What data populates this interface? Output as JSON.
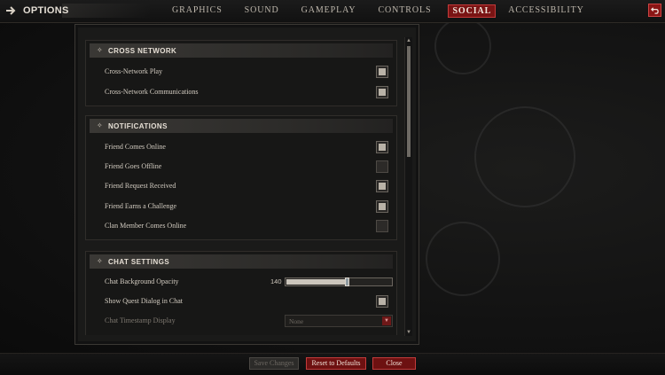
{
  "header": {
    "title": "OPTIONS",
    "tabs": [
      {
        "label": "GRAPHICS",
        "active": false
      },
      {
        "label": "SOUND",
        "active": false
      },
      {
        "label": "GAMEPLAY",
        "active": false
      },
      {
        "label": "CONTROLS",
        "active": false
      },
      {
        "label": "SOCIAL",
        "active": true
      },
      {
        "label": "ACCESSIBILITY",
        "active": false
      }
    ]
  },
  "sections": {
    "cross_network": {
      "title": "CROSS NETWORK",
      "items": [
        {
          "label": "Cross-Network Play",
          "checked": true
        },
        {
          "label": "Cross-Network Communications",
          "checked": true
        }
      ]
    },
    "notifications": {
      "title": "NOTIFICATIONS",
      "items": [
        {
          "label": "Friend Comes Online",
          "checked": true
        },
        {
          "label": "Friend Goes Offline",
          "checked": false
        },
        {
          "label": "Friend Request Received",
          "checked": true
        },
        {
          "label": "Friend Earns a Challenge",
          "checked": true
        },
        {
          "label": "Clan Member Comes Online",
          "checked": false
        }
      ]
    },
    "chat_settings": {
      "title": "CHAT SETTINGS",
      "opacity_label": "Chat Background Opacity",
      "opacity_value": "140",
      "opacity_fraction": 0.55,
      "quest_label": "Show Quest Dialog in Chat",
      "quest_checked": true,
      "timestamp_label": "Chat Timestamp Display",
      "timestamp_value": "None"
    }
  },
  "footer": {
    "save": "Save Changes",
    "reset": "Reset to Defaults",
    "close": "Close"
  },
  "colors": {
    "accent_red": "#7a1414",
    "checkbox_fill": "#b9b2a7"
  }
}
